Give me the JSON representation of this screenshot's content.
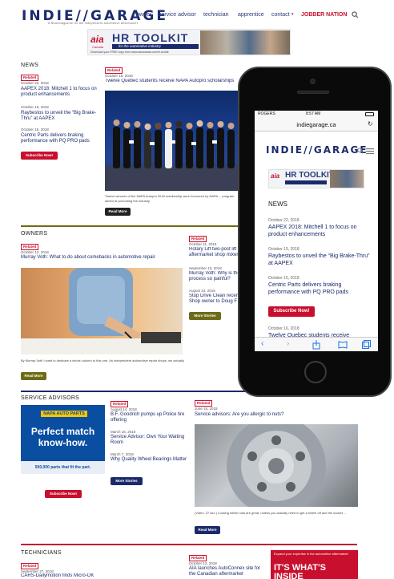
{
  "site": {
    "logo": "INDIE//GARAGE",
    "logo_tagline": "A Newsmagazine for the independent automotive aftermarket",
    "nav": [
      "owner",
      "service advisor",
      "technician",
      "apprentice",
      "contact",
      "JOBBER NATION"
    ]
  },
  "banner": {
    "brand": "aia",
    "brand_sub": "Canada",
    "title": "HR TOOLKIT",
    "strip": "for the automotive industry",
    "small": "Download your FREE copy from www.aiacanada.com/hr-toolkit"
  },
  "news": {
    "title": "NEWS",
    "items": [
      {
        "date": "October 22, 2018",
        "headline": "AAPEX 2018: Mitchell 1 to focus on product enhancements"
      },
      {
        "date": "October 19, 2018",
        "headline": "Raybestos to unveil the “Big Brake-Thru” at AAPEX"
      },
      {
        "date": "October 15, 2018",
        "headline": "Centric Parts delivers braking performance with PQ PRO pads"
      }
    ],
    "subscribe": "Subscribe Now!",
    "feature": {
      "tag": "Related",
      "date": "October 16, 2018",
      "headline": "Twelve Quebec students receive NAPA Autopro scholarships",
      "caption": "Twelve winners of the NAPA Autopro 2018 scholarship were honoured by NAPA ... program aimed at promoting the industry",
      "button": "Read More"
    }
  },
  "owners": {
    "title": "OWNERS",
    "feature": {
      "tag": "Related",
      "date": "October 12, 2018",
      "headline": "Murray Voth: What to do about comebacks in automotive repair",
      "caption": "By Murray Voth I want to dedicate a whole column to this one. As independent automotive repair shops, we actually ...",
      "button": "Read More"
    },
    "side_items": [
      {
        "date": "October 11, 2018",
        "headline": "Rotary Lift two-post lift aftermarket shop mixer"
      },
      {
        "date": "September 13, 2018",
        "headline": "Murray Voth: Why is the process so painful?"
      },
      {
        "date": "August 24, 2018",
        "headline": "Stop Drive Clean recert Shop owner to Doug F"
      }
    ],
    "side_tag": "Related",
    "more": "More Stories"
  },
  "service": {
    "title": "SERVICE ADVISORS",
    "ad": {
      "brand": "NAPA AUTO PARTS",
      "headline": "Perfect match know-how.",
      "footer": "500,000 parts that fit the part."
    },
    "subscribe": "Subscribe Now!",
    "list_tag": "Related",
    "items": [
      {
        "date": "August 14, 2018",
        "headline": "B.F. Goodrich pumps up Police tire offering"
      },
      {
        "date": "March 16, 2018",
        "headline": "Service Advisor: Own Your Waiting Room"
      },
      {
        "date": "March 7, 2018",
        "headline": "Why Quality Wheel Bearings Matter"
      }
    ],
    "more": "More Stories",
    "feature": {
      "tag": "Related",
      "date": "June 18, 2018",
      "headline": "Service advisors: Are you allergic to nuts?",
      "caption": "(Video: 37 sec.) Locking wheel nuts are great, unless you actually need to get a wheel off and the socket ...",
      "button": "Read More"
    }
  },
  "technicians": {
    "title": "TECHNICIANS",
    "left": {
      "tag": "Related",
      "date": "September 27, 2018",
      "headline": "CARS-Dailymotion finds Micro-OK"
    },
    "mid": {
      "tag": "Related",
      "date": "October 12, 2018",
      "headline": "AIA launches AutoConnex site for the Canadian aftermarket"
    },
    "ad": {
      "top": "Expand your expertise in the automotive aftermarket",
      "big": "IT'S WHAT'S INSIDE"
    }
  },
  "phone": {
    "carrier": "ROGERS",
    "time": "8:57 AM",
    "url": "indiegarage.ca",
    "logo": "INDIE//GARAGE",
    "banner_title": "HR TOOLKIT",
    "news_title": "NEWS",
    "items": [
      {
        "date": "October 22, 2018",
        "headline": "AAPEX 2018: Mitchell 1 to focus on product enhancements"
      },
      {
        "date": "October 19, 2018",
        "headline": "Raybestos to unveil the “Big Brake-Thru” at AAPEX"
      },
      {
        "date": "October 15, 2018",
        "headline": "Centric Parts delivers braking performance with PQ PRO pads"
      }
    ],
    "subscribe": "Subscribe Now!",
    "next_date": "October 16, 2018",
    "next_headline": "Twelve Quebec students receive"
  },
  "colors": {
    "navy": "#1b2a6b",
    "red": "#c8102e",
    "olive": "#6d6b16",
    "napa_blue": "#0a4ea2",
    "napa_yellow": "#f6c500"
  }
}
